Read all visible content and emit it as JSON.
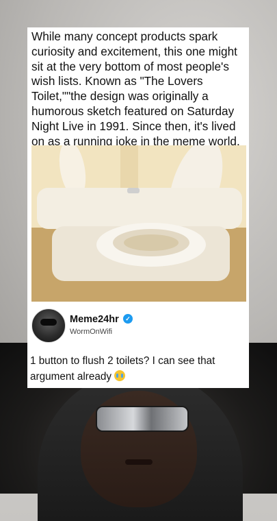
{
  "post": {
    "caption": "While many concept products spark curiosity and excitement, this one might sit at the very bottom of most people's wish lists. Known as \"The Lovers Toilet,\"\"the design was originally a humorous sketch featured on Saturday Night Live in 1991. Since then, it's lived on as a running joke in the meme world.",
    "image_alt": "toilet-photo"
  },
  "author": {
    "name": "Meme24hr",
    "handle": "WormOnWifi",
    "verified_icon": "verified-check-icon"
  },
  "tweet": {
    "text": "1 button to flush 2 toilets? I can see that argument already",
    "emoji": "crying-face-emoji"
  }
}
